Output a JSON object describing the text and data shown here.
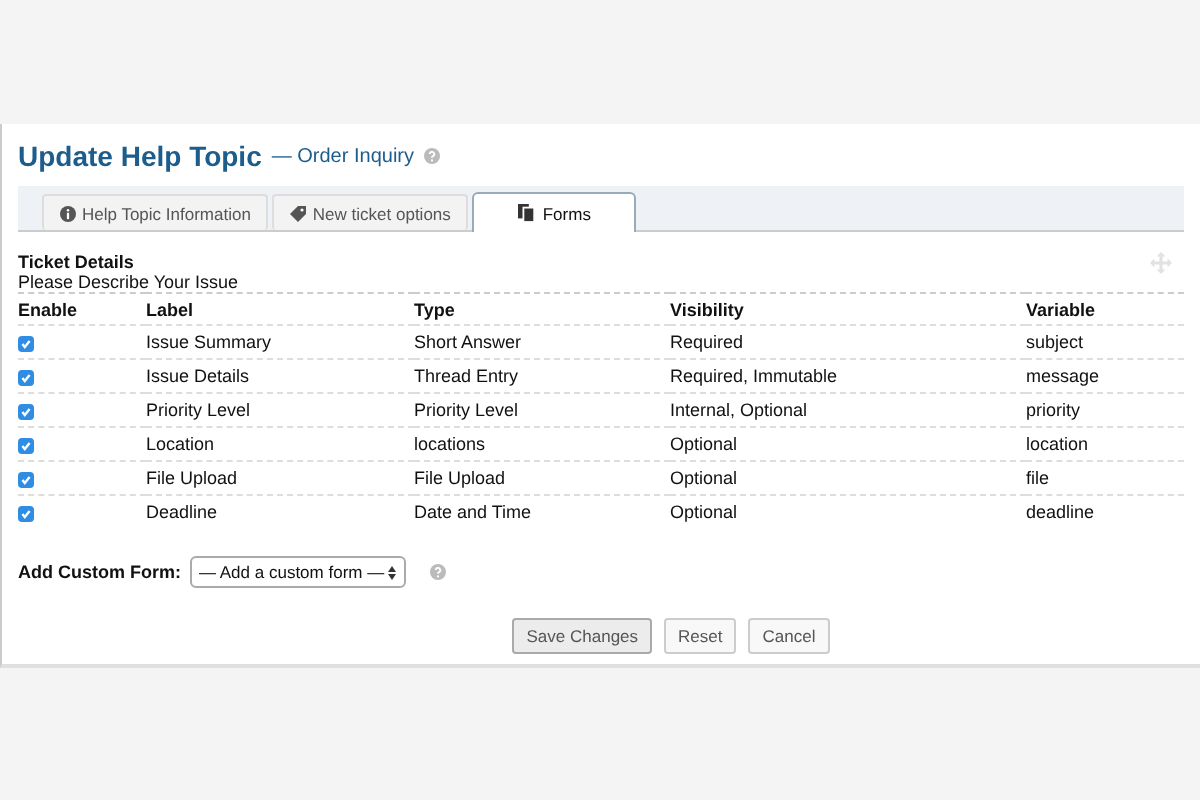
{
  "header": {
    "title": "Update Help Topic",
    "subtitle": "— Order Inquiry"
  },
  "tabs": [
    {
      "label": "Help Topic Information",
      "kind": "info",
      "selected": false
    },
    {
      "label": "New ticket options",
      "kind": "options",
      "selected": false
    },
    {
      "label": "Forms",
      "kind": "forms",
      "selected": true
    }
  ],
  "form": {
    "title": "Ticket Details",
    "description": "Please Describe Your Issue"
  },
  "table": {
    "columns": [
      "Enable",
      "Label",
      "Type",
      "Visibility",
      "Variable"
    ],
    "rows": [
      {
        "enabled": true,
        "label": "Issue Summary",
        "type": "Short Answer",
        "visibility": "Required",
        "variable": "subject"
      },
      {
        "enabled": true,
        "label": "Issue Details",
        "type": "Thread Entry",
        "visibility": "Required, Immutable",
        "variable": "message"
      },
      {
        "enabled": true,
        "label": "Priority Level",
        "type": "Priority Level",
        "visibility": "Internal, Optional",
        "variable": "priority"
      },
      {
        "enabled": true,
        "label": "Location",
        "type": "locations",
        "visibility": "Optional",
        "variable": "location"
      },
      {
        "enabled": true,
        "label": "File Upload",
        "type": "File Upload",
        "visibility": "Optional",
        "variable": "file"
      },
      {
        "enabled": true,
        "label": "Deadline",
        "type": "Date and Time",
        "visibility": "Optional",
        "variable": "deadline"
      }
    ]
  },
  "custom_form": {
    "label": "Add Custom Form:",
    "value": "— Add a custom form —"
  },
  "buttons": [
    "Save Changes",
    "Reset",
    "Cancel"
  ]
}
